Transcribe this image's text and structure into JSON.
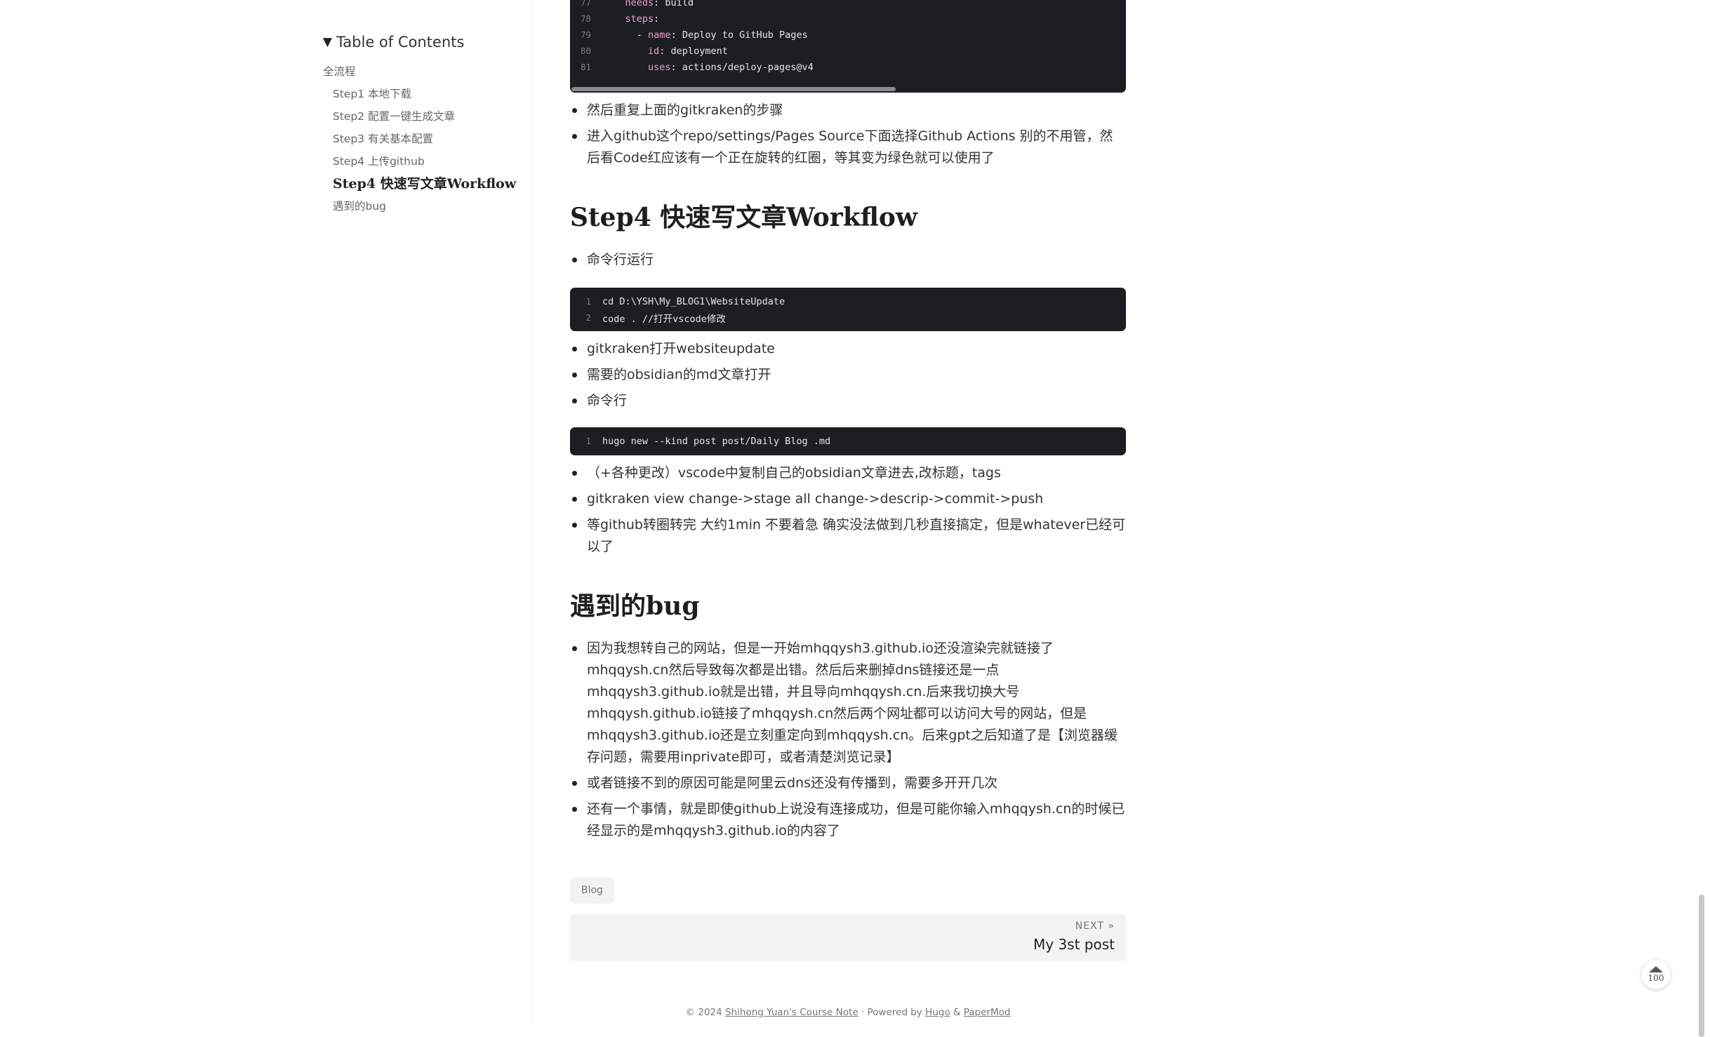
{
  "toc": {
    "title": "Table of Contents",
    "toggle_glyph": "▼",
    "items": [
      {
        "label": "全流程",
        "level": 1
      },
      {
        "label": "Step1 本地下载",
        "level": 2
      },
      {
        "label": "Step2 配置一键生成文章",
        "level": 2
      },
      {
        "label": "Step3 有关基本配置",
        "level": 2
      },
      {
        "label": "Step4 上传github",
        "level": 2
      },
      {
        "label": "Step4 快速写文章Workflow",
        "level": 2,
        "active": true
      },
      {
        "label": "遇到的bug",
        "level": 2
      }
    ]
  },
  "code_top": {
    "lines": [
      {
        "n": "77",
        "key": "needs",
        "rest": ": build",
        "indent": "    "
      },
      {
        "n": "78",
        "key": "steps",
        "rest": ":",
        "indent": "    "
      },
      {
        "n": "79",
        "pre": "- ",
        "key": "name",
        "rest": ": Deploy to GitHub Pages",
        "indent": "      "
      },
      {
        "n": "80",
        "key": "id",
        "rest": ": deployment",
        "indent": "        "
      },
      {
        "n": "81",
        "key": "uses",
        "rest": ": actions/deploy-pages@v4",
        "indent": "        "
      }
    ]
  },
  "bullets_a": [
    "然后重复上面的gitkraken的步骤",
    "进入github这个repo/settings/Pages Source下面选择Github Actions 别的不用管，然后看Code红应该有一个正在旋转的红圈，等其变为绿色就可以使用了"
  ],
  "heading_workflow": "Step4 快速写文章Workflow",
  "bullets_b": [
    "命令行运行"
  ],
  "code_cd": {
    "lines": [
      {
        "n": "1",
        "text": "cd D:\\YSH\\My_BLOG1\\WebsiteUpdate"
      },
      {
        "n": "2",
        "text": "code . //打开vscode修改"
      }
    ]
  },
  "bullets_c": [
    "gitkraken打开websiteupdate",
    "需要的obsidian的md文章打开",
    "命令行"
  ],
  "code_hugo": {
    "lines": [
      {
        "n": "1",
        "text": "hugo new --kind post post/Daily Blog .md"
      }
    ]
  },
  "bullets_d": [
    "（+各种更改）vscode中复制自己的obsidian文章进去,改标题，tags",
    "gitkraken view change->stage all change->descrip->commit->push",
    "等github转圈转完 大约1min 不要着急 确实没法做到几秒直接搞定，但是whatever已经可以了"
  ],
  "heading_bug": "遇到的bug",
  "bullets_e": [
    "因为我想转自己的网站，但是一开始mhqqysh3.github.io还没渲染完就链接了mhqqysh.cn然后导致每次都是出错。然后后来删掉dns链接还是一点mhqqysh3.github.io就是出错，并且导向mhqqysh.cn.后来我切换大号mhqqysh.github.io链接了mhqqysh.cn然后两个网址都可以访问大号的网站，但是mhqqysh3.github.io还是立刻重定向到mhqqysh.cn。后来gpt之后知道了是【浏览器缓存问题，需要用inprivate即可，或者清楚浏览记录】",
    "或者链接不到的原因可能是阿里云dns还没有传播到，需要多开开几次",
    "还有一个事情，就是即使github上说没有连接成功，但是可能你输入mhqqysh.cn的时候已经显示的是mhqqysh3.github.io的内容了"
  ],
  "tag": "Blog",
  "next": {
    "label": "NEXT »",
    "title": "My 3st post"
  },
  "footer": {
    "prefix": "© 2024 ",
    "site": "Shihong Yuan's Course Note",
    "sep1": " · Powered by ",
    "hugo": "Hugo",
    "amp": " & ",
    "papermod": "PaperMod"
  },
  "top_button": {
    "value": "100"
  }
}
